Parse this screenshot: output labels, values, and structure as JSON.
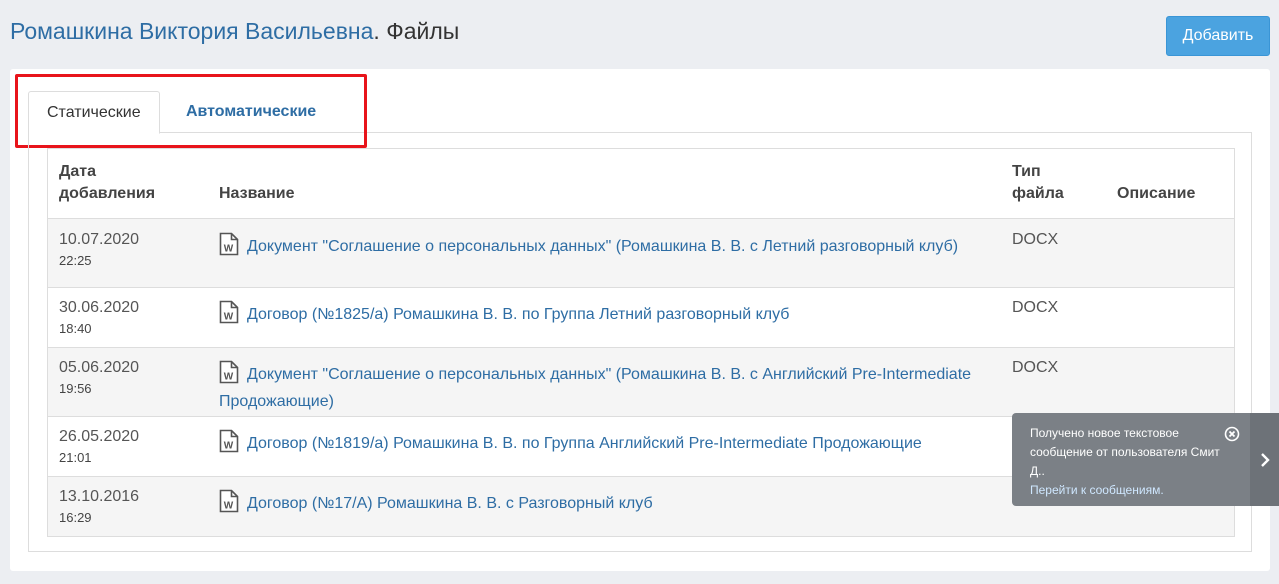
{
  "header": {
    "person": "Ромашкина Виктория Васильевна",
    "suffix": ". Файлы",
    "add_label": "Добавить"
  },
  "tabs": [
    {
      "label": "Статические",
      "active": true
    },
    {
      "label": "Автоматические",
      "active": false
    }
  ],
  "table": {
    "columns": {
      "date_line1": "Дата",
      "date_line2": "добавления",
      "name": "Название",
      "type_line1": "Тип",
      "type_line2": "файла",
      "description": "Описание"
    },
    "rows": [
      {
        "date": "10.07.2020",
        "time": "22:25",
        "name": "Документ \"Соглашение о персональных данных\" (Ромашкина В. В. с Летний разговорный клуб)",
        "type": "DOCX",
        "description": ""
      },
      {
        "date": "30.06.2020",
        "time": "18:40",
        "name": "Договор (№1825/а) Ромашкина В. В. по Группа Летний разговорный клуб",
        "type": "DOCX",
        "description": ""
      },
      {
        "date": "05.06.2020",
        "time": "19:56",
        "name": "Документ \"Соглашение о персональных данных\" (Ромашкина В. В. с Английский Pre-Intermediate Продожающие)",
        "type": "DOCX",
        "description": ""
      },
      {
        "date": "26.05.2020",
        "time": "21:01",
        "name": "Договор (№1819/а) Ромашкина В. В. по Группа Английский Pre-Intermediate Продожающие",
        "type": "",
        "description": ""
      },
      {
        "date": "13.10.2016",
        "time": "16:29",
        "name": "Договор (№17/А) Ромашкина В. В. с Разговорный клуб",
        "type": "",
        "description": ""
      }
    ]
  },
  "notification": {
    "text": "Получено новое текстовое сообщение от пользователя Смит Д..",
    "link": "Перейти к сообщениям."
  },
  "colors": {
    "accent": "#2e6da4",
    "button": "#4ba3e0",
    "highlight": "#e8141b",
    "notification": "#7b8086"
  },
  "icons": [
    "word-document-icon",
    "close-circle-icon",
    "chevron-right-icon"
  ]
}
